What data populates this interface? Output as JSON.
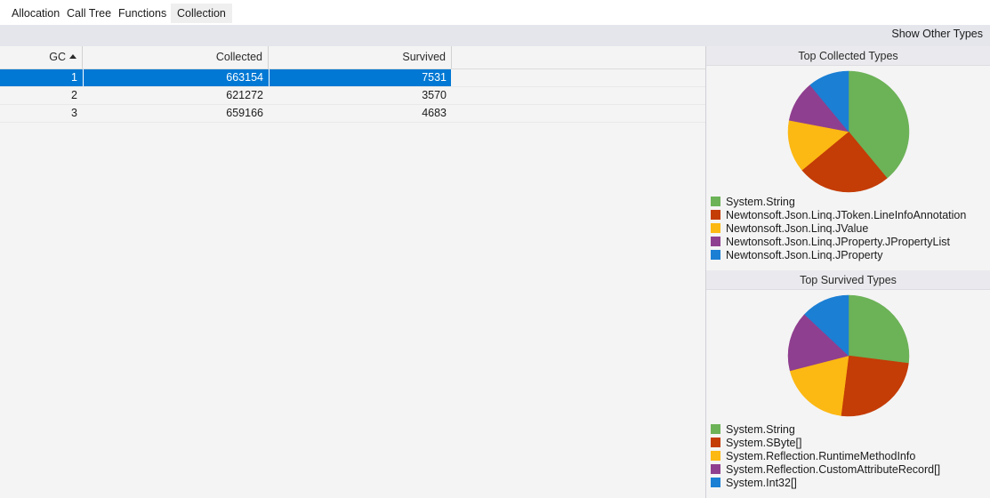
{
  "tabs": [
    {
      "label": "Allocation",
      "selected": false
    },
    {
      "label": "Call Tree",
      "selected": false
    },
    {
      "label": "Functions",
      "selected": false
    },
    {
      "label": "Collection",
      "selected": true
    }
  ],
  "toolbar": {
    "show_other_types_label": "Show Other Types"
  },
  "grid": {
    "columns": [
      {
        "label": "GC",
        "sorted": "ascending"
      },
      {
        "label": "Collected",
        "sorted": "none"
      },
      {
        "label": "Survived",
        "sorted": "none"
      },
      {
        "label": "",
        "sorted": "none"
      }
    ],
    "rows": [
      {
        "gc": "1",
        "collected": "663154",
        "survived": "7531",
        "selected": true
      },
      {
        "gc": "2",
        "collected": "621272",
        "survived": "3570",
        "selected": false
      },
      {
        "gc": "3",
        "collected": "659166",
        "survived": "4683",
        "selected": false
      }
    ],
    "selection_color": "#0078d4"
  },
  "palette": {
    "green": "#6cb257",
    "orange": "#c43c06",
    "yellow": "#fcb813",
    "purple": "#8f3f8f",
    "blue": "#1b7fd4"
  },
  "chart_data": [
    {
      "type": "pie",
      "title": "Top Collected Types",
      "legend_position": "bottom",
      "categories": [
        "System.String",
        "Newtonsoft.Json.Linq.JToken.LineInfoAnnotation",
        "Newtonsoft.Json.Linq.JValue",
        "Newtonsoft.Json.Linq.JProperty.JPropertyList",
        "Newtonsoft.Json.Linq.JProperty"
      ],
      "values": [
        39,
        25,
        14,
        11,
        11
      ],
      "colors": [
        "#6cb257",
        "#c43c06",
        "#fcb813",
        "#8f3f8f",
        "#1b7fd4"
      ]
    },
    {
      "type": "pie",
      "title": "Top Survived Types",
      "legend_position": "bottom",
      "categories": [
        "System.String",
        "System.SByte[]",
        "System.Reflection.RuntimeMethodInfo",
        "System.Reflection.CustomAttributeRecord[]",
        "System.Int32[]"
      ],
      "values": [
        27,
        25,
        19,
        16,
        13
      ],
      "colors": [
        "#6cb257",
        "#c43c06",
        "#fcb813",
        "#8f3f8f",
        "#1b7fd4"
      ]
    }
  ]
}
